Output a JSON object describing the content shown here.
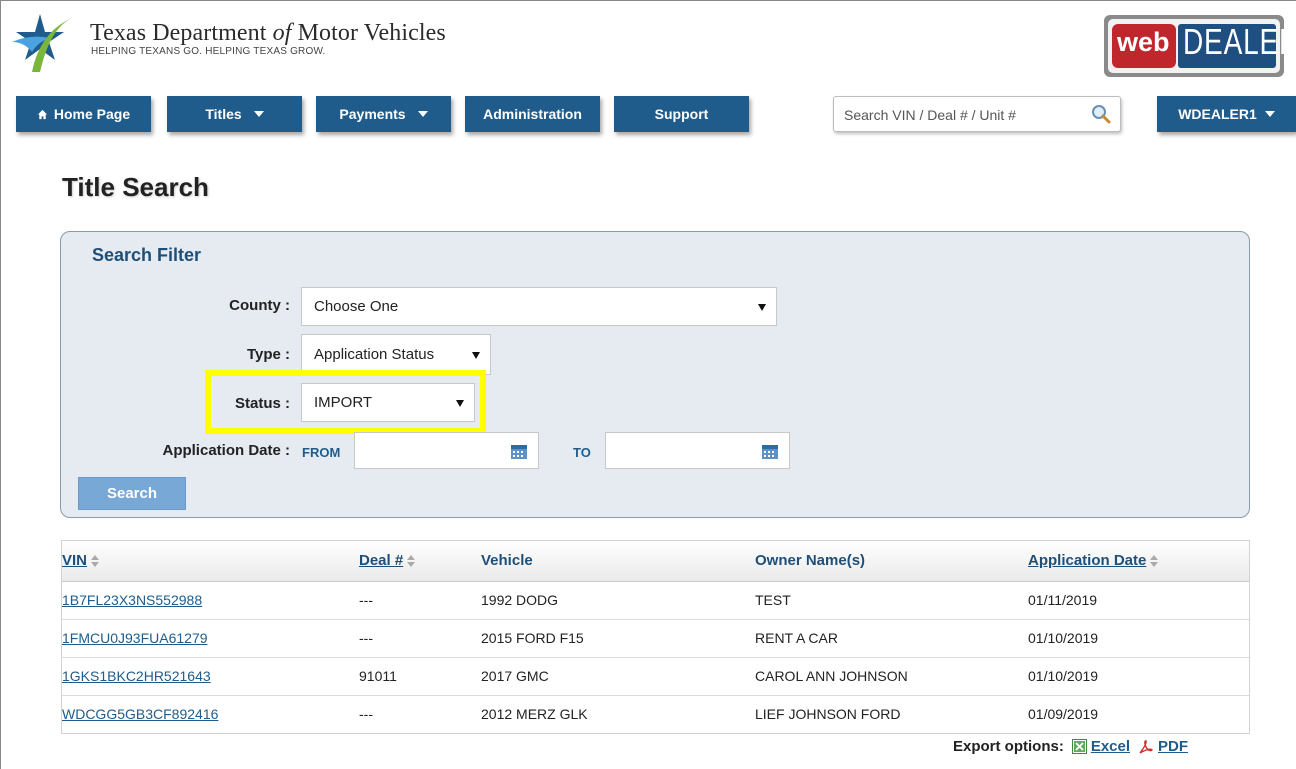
{
  "header": {
    "agency_prefix": "Texas Department ",
    "agency_of": "of",
    "agency_suffix": " Motor Vehicles",
    "tagline": "HELPING TEXANS GO. HELPING TEXAS GROW.",
    "brand_web": "web",
    "brand_dealer": "DEALER"
  },
  "nav": {
    "home": "Home Page",
    "titles": "Titles",
    "payments": "Payments",
    "administration": "Administration",
    "support": "Support",
    "search_placeholder": "Search VIN / Deal # / Unit #",
    "user": "WDEALER1"
  },
  "page": {
    "title": "Title Search"
  },
  "filter": {
    "title": "Search Filter",
    "county_label": "County :",
    "county_value": "Choose One",
    "type_label": "Type :",
    "type_value": "Application Status",
    "status_label": "Status :",
    "status_value": "IMPORT",
    "app_date_label": "Application Date :",
    "from_label": "FROM",
    "to_label": "TO",
    "search_button": "Search"
  },
  "table": {
    "headers": {
      "vin": "VIN",
      "deal": "Deal #",
      "vehicle": "Vehicle",
      "owner": "Owner Name(s)",
      "app_date": "Application Date"
    },
    "rows": [
      {
        "vin": "1B7FL23X3NS552988",
        "deal": "---",
        "vehicle": "1992 DODG",
        "owner": "TEST",
        "app_date": "01/11/2019"
      },
      {
        "vin": "1FMCU0J93FUA61279",
        "deal": "---",
        "vehicle": "2015 FORD F15",
        "owner": "RENT A CAR",
        "app_date": "01/10/2019"
      },
      {
        "vin": "1GKS1BKC2HR521643",
        "deal": "91011",
        "vehicle": "2017 GMC",
        "owner": "CAROL ANN JOHNSON",
        "app_date": "01/10/2019"
      },
      {
        "vin": "WDCGG5GB3CF892416",
        "deal": "---",
        "vehicle": "2012 MERZ GLK",
        "owner": "LIEF JOHNSON FORD",
        "app_date": "01/09/2019"
      }
    ]
  },
  "export": {
    "label": "Export options:",
    "excel": "Excel",
    "pdf": "PDF"
  },
  "icons": {
    "home": "home-icon",
    "search": "magnifier-icon",
    "calendar": "calendar-icon",
    "excel": "excel-icon",
    "pdf": "pdf-icon"
  },
  "colors": {
    "nav_blue": "#1f5c8c",
    "panel_bg": "#e5ebf1",
    "highlight": "#ffff00",
    "search_button": "#78a8d6",
    "brand_red": "#c0272d"
  }
}
